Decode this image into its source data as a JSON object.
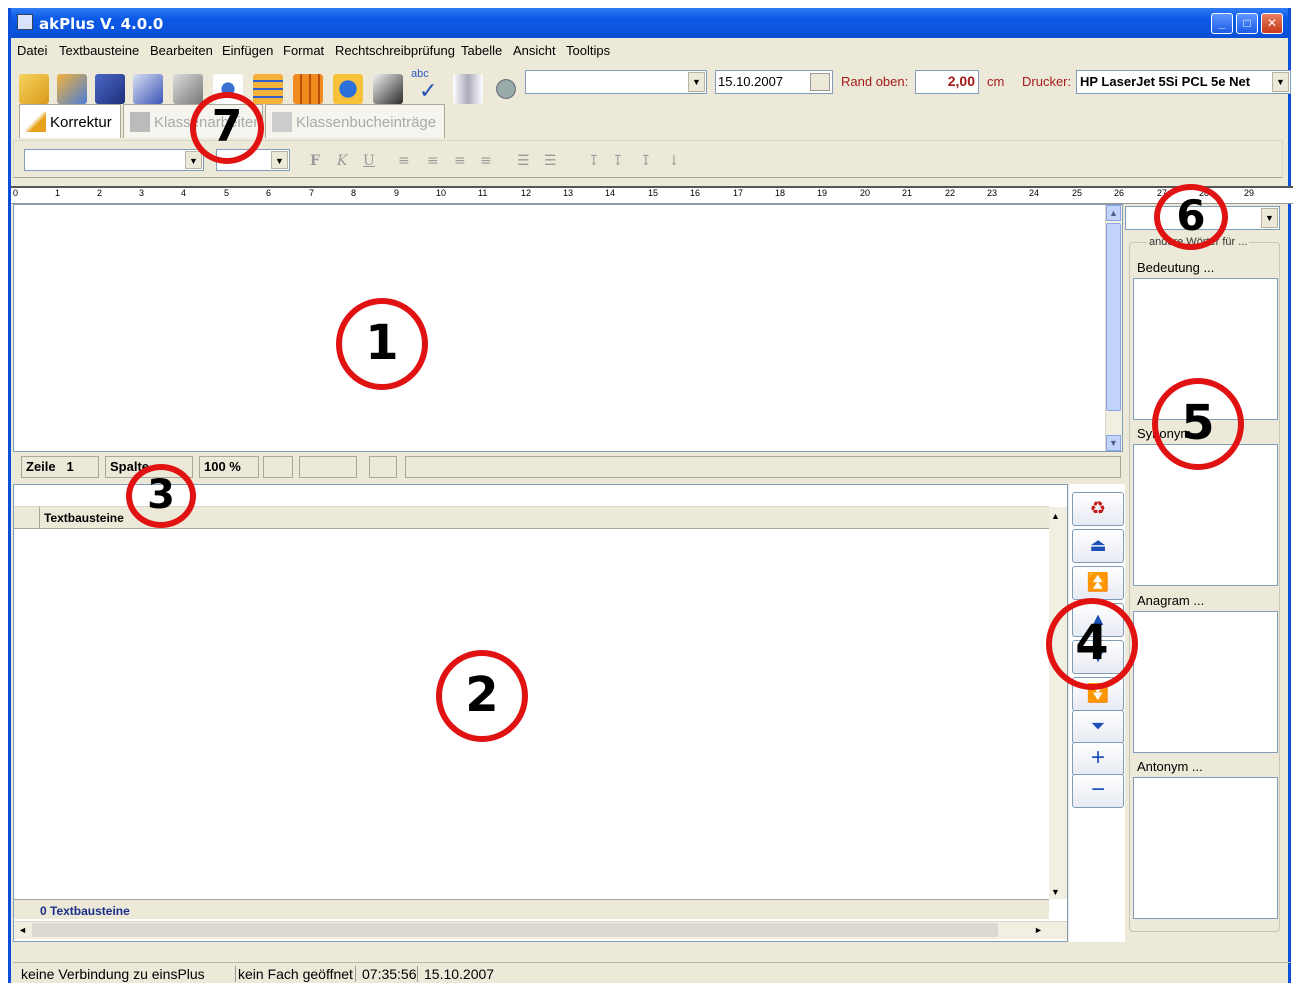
{
  "window": {
    "title": "akPlus V. 4.0.0",
    "min_glyph": "_",
    "max_glyph": "□",
    "close_glyph": "✕"
  },
  "menu": [
    "Datei",
    "Textbausteine",
    "Bearbeiten",
    "Einfügen",
    "Format",
    "Rechtschreibprüfung",
    "Tabelle",
    "Ansicht",
    "Tooltips"
  ],
  "toolbar": {
    "date_value": "15.10.2007",
    "rand_label": "Rand oben:",
    "rand_value": "2,00",
    "rand_unit": "cm",
    "printer_label": "Drucker:",
    "printer_value": "HP LaserJet 5Si PCL 5e Net",
    "spell_label": "abc"
  },
  "tabs": [
    "Korrektur",
    "Klassenarbeiten",
    "Klassenbucheinträge"
  ],
  "format_buttons": [
    "F",
    "K",
    "U"
  ],
  "ruler": [
    "0",
    "1",
    "2",
    "3",
    "4",
    "5",
    "6",
    "7",
    "8",
    "9",
    "10",
    "11",
    "12",
    "13",
    "14",
    "15",
    "16",
    "17",
    "18",
    "19",
    "20",
    "21",
    "22",
    "23",
    "24",
    "25",
    "26",
    "27",
    "28",
    "29"
  ],
  "editor_status": {
    "zeile_label": "Zeile",
    "zeile_value": "1",
    "spalte_label": "Spalte",
    "zoom": "100 %"
  },
  "grid": {
    "column_header": "Textbausteine",
    "footer": "0 Textbausteine"
  },
  "right_panel": {
    "group_label": "andere Wörter für ...",
    "sections": [
      "Bedeutung ...",
      "Synonym ...",
      "Anagram ...",
      "Antonym ..."
    ]
  },
  "status_bar": [
    "keine Verbindung zu einsPlus",
    "kein Fach geöffnet",
    "07:35:56",
    "15.10.2007"
  ],
  "markers": [
    "1",
    "2",
    "3",
    "4",
    "5",
    "6",
    "7"
  ]
}
